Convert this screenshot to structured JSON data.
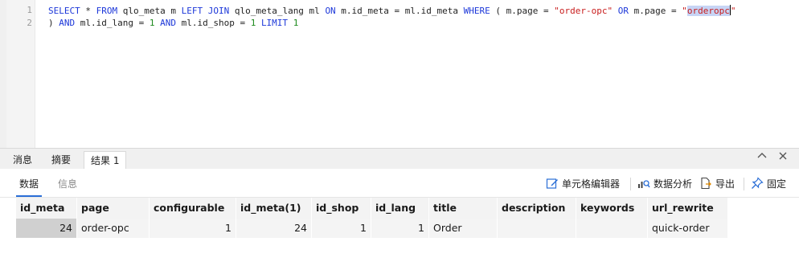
{
  "editor": {
    "line_numbers": [
      "1",
      "2"
    ],
    "line1": {
      "p1": "SELECT",
      "p2": " * ",
      "p3": "FROM",
      "p4": " qlo_meta m ",
      "p5": "LEFT JOIN",
      "p6": " qlo_meta_lang ml ",
      "p7": "ON",
      "p8": " m.id_meta = ml.id_meta ",
      "p9": "WHERE",
      "p10": " ( m.page = ",
      "p11": "\"order-opc\"",
      "p12": " ",
      "p13": "OR",
      "p14": " m.page = ",
      "p15": "\"",
      "p16": "orderopc",
      "p17": "\""
    },
    "line2": {
      "p1": ") ",
      "p2": "AND",
      "p3": " ml.id_lang = ",
      "p4": "1",
      "p5": " ",
      "p6": "AND",
      "p7": " ml.id_shop = ",
      "p8": "1",
      "p9": " ",
      "p10": "LIMIT",
      "p11": " ",
      "p12": "1"
    }
  },
  "panel_tabs": [
    "消息",
    "摘要",
    "结果 1"
  ],
  "window_buttons": {
    "collapse": "^",
    "close": "×"
  },
  "sub_tabs": [
    "数据",
    "信息"
  ],
  "toolbar": {
    "cell_editor": "单元格编辑器",
    "data_analysis": "数据分析",
    "export": "导出",
    "pin": "固定"
  },
  "table": {
    "headers": [
      "id_meta",
      "page",
      "configurable",
      "id_meta(1)",
      "id_shop",
      "id_lang",
      "title",
      "description",
      "keywords",
      "url_rewrite"
    ],
    "rows": [
      [
        "24",
        "order-opc",
        "1",
        "24",
        "1",
        "1",
        "Order",
        "",
        "",
        "quick-order"
      ]
    ]
  }
}
